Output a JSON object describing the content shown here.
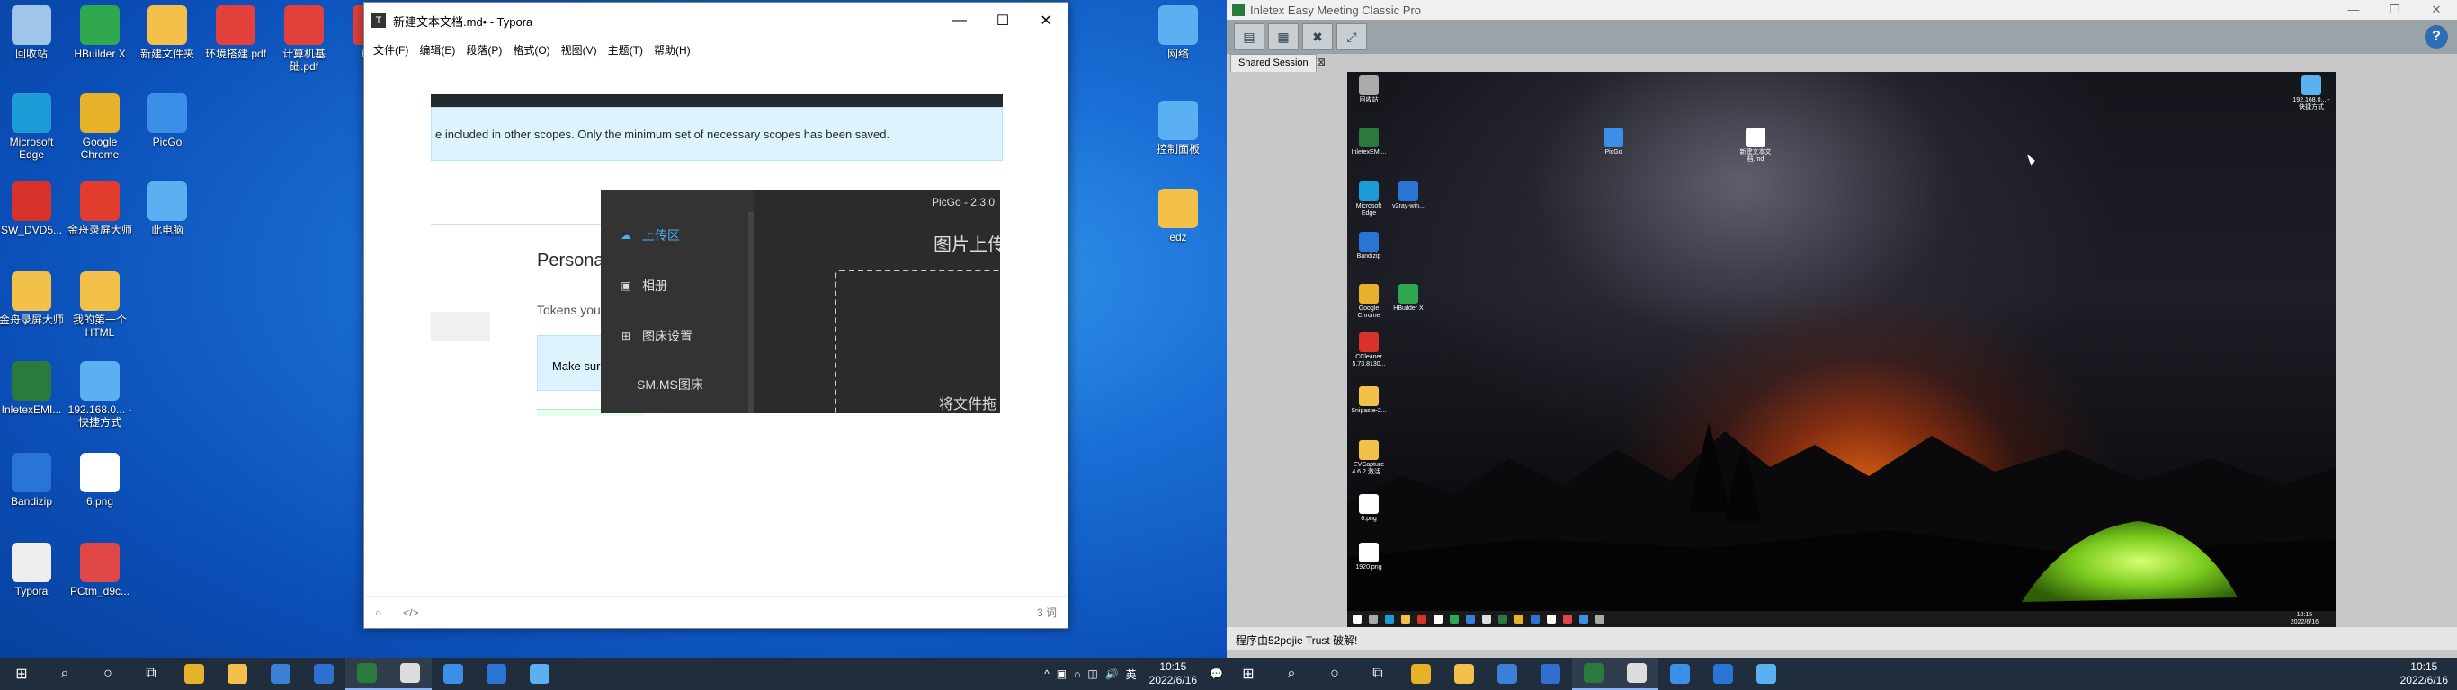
{
  "left": {
    "desktop_icons": [
      {
        "label": "回收站",
        "icon": "recycle-bin-icon",
        "color": "#9fc5e8"
      },
      {
        "label": "HBuilder X",
        "icon": "hbuilder-icon",
        "color": "#2fa84f"
      },
      {
        "label": "新建文件夹",
        "icon": "folder-icon",
        "color": "#f3c04a"
      },
      {
        "label": "环境搭建.pdf",
        "icon": "pdf-icon",
        "color": "#e2413b"
      },
      {
        "label": "计算机基础.pdf",
        "icon": "pdf-icon",
        "color": "#e2413b"
      },
      {
        "label": "HTN",
        "icon": "pdf-icon",
        "color": "#e2413b"
      },
      {
        "label": "Microsoft Edge",
        "icon": "edge-icon",
        "color": "#1d9bd7"
      },
      {
        "label": "Google Chrome",
        "icon": "chrome-icon",
        "color": "#e7b22a"
      },
      {
        "label": "PicGo",
        "icon": "picgo-icon",
        "color": "#3b8fe8"
      },
      {
        "label": "SW_DVD5...",
        "icon": "iso-icon",
        "color": "#d9322b"
      },
      {
        "label": "金舟录屏大师",
        "icon": "recorder-icon",
        "color": "#e23c2f"
      },
      {
        "label": "此电脑",
        "icon": "computer-icon",
        "color": "#5ab0f0"
      },
      {
        "label": "金舟录屏大师",
        "icon": "folder-icon",
        "color": "#f3c04a"
      },
      {
        "label": "我的第一个HTML",
        "icon": "chrome-file-icon",
        "color": "#f3c04a"
      },
      {
        "label": "InletexEMI...",
        "icon": "inletex-icon",
        "color": "#2b7a3d"
      },
      {
        "label": "192.168.0... - 快捷方式",
        "icon": "remote-pc-icon",
        "color": "#5ab0f0"
      },
      {
        "label": "Bandizip",
        "icon": "bandizip-icon",
        "color": "#2a74d6"
      },
      {
        "label": "6.png",
        "icon": "image-file-icon",
        "color": "#ffffff"
      },
      {
        "label": "Typora",
        "icon": "typora-icon",
        "color": "#eeeeee"
      },
      {
        "label": "PCtm_d9c...",
        "icon": "image-file-icon",
        "color": "#e04848"
      },
      {
        "label": "网络",
        "icon": "network-icon",
        "color": "#5ab0f0"
      },
      {
        "label": "控制面板",
        "icon": "control-panel-icon",
        "color": "#5ab0f0"
      },
      {
        "label": "edz",
        "icon": "user-folder-icon",
        "color": "#f3c04a"
      }
    ],
    "typora": {
      "title": "新建文本文档.md• - Typora",
      "app_icon": "T",
      "controls": {
        "minimize": "—",
        "maximize": "☐",
        "close": "✕"
      },
      "menu": [
        "文件(F)",
        "编辑(E)",
        "段落(P)",
        "格式(O)",
        "视图(V)",
        "主题(T)",
        "帮助(H)"
      ],
      "info_text": "e included in other scopes. Only the minimum set of necessary scopes has been saved.",
      "personal": "Personal",
      "tokens": "Tokens you",
      "make_sure": "Make sur",
      "status_left_icon": "○",
      "status_code_icon": "</>",
      "word_count": "3 词"
    },
    "picgo": {
      "title": "PicGo - 2.3.0",
      "menu": [
        {
          "label": "上传区",
          "icon": "cloud-upload-icon",
          "glyph": "☁",
          "active": true
        },
        {
          "label": "相册",
          "icon": "album-icon",
          "glyph": "▣",
          "active": false
        },
        {
          "label": "图床设置",
          "icon": "grid-icon",
          "glyph": "⊞",
          "active": false
        },
        {
          "label": "SM.MS图床",
          "icon": "",
          "glyph": "",
          "active": false
        }
      ],
      "heading": "图片上传",
      "drop_text": "将文件拖"
    },
    "taskbar": {
      "start": "⊞",
      "search": "⌕",
      "cortana": "○",
      "taskview": "⧉",
      "apps": [
        {
          "name": "chrome",
          "color": "#e7b22a",
          "active": false
        },
        {
          "name": "explorer",
          "color": "#f3c04a",
          "active": false
        },
        {
          "name": "store",
          "color": "#3b7fd6",
          "active": false
        },
        {
          "name": "mail",
          "color": "#2f6fd0",
          "active": false
        },
        {
          "name": "inletex",
          "color": "#2b7a3d",
          "active": true
        },
        {
          "name": "typora",
          "color": "#dddddd",
          "active": true
        },
        {
          "name": "picgo",
          "color": "#3b8fe8",
          "active": false
        },
        {
          "name": "vscode-like",
          "color": "#2a74d6",
          "active": false
        },
        {
          "name": "remote",
          "color": "#5ab0f0",
          "active": false
        }
      ],
      "tray": [
        "^",
        "▣",
        "⌂",
        "◫",
        "🔊",
        "英"
      ],
      "time": "10:15",
      "date": "2022/6/16",
      "notify": "💬"
    }
  },
  "meeting": {
    "title": "Inletex Easy Meeting Classic Pro",
    "controls": {
      "minimize": "—",
      "maximize": "❐",
      "close": "✕"
    },
    "tools": [
      "▤",
      "▦",
      "✖",
      "⤢"
    ],
    "help": "?",
    "tab": "Shared Session",
    "tab_close": "⊠",
    "status": "程序由52pojie Trust 破解!",
    "remote": {
      "icons": [
        {
          "label": "回收站",
          "color": "#aaaaaa"
        },
        {
          "label": "InletexEMI...",
          "color": "#2b7a3d"
        },
        {
          "label": "PicGo",
          "color": "#3b8fe8"
        },
        {
          "label": "新建文本文档.md",
          "color": "#ffffff"
        },
        {
          "label": "Microsoft Edge",
          "color": "#1d9bd7"
        },
        {
          "label": "v2ray-win...",
          "color": "#2a74d6"
        },
        {
          "label": "Bandizip",
          "color": "#2a74d6"
        },
        {
          "label": "Google Chrome",
          "color": "#e7b22a"
        },
        {
          "label": "HBuilder X",
          "color": "#2fa84f"
        },
        {
          "label": "CCleaner 5.73.8130...",
          "color": "#d9322b"
        },
        {
          "label": "Snipaste-2...",
          "color": "#f3c04a"
        },
        {
          "label": "EVCapture 4.6.2 激活...",
          "color": "#f3c04a"
        },
        {
          "label": "6.png",
          "color": "#ffffff"
        },
        {
          "label": "1920.png",
          "color": "#ffffff"
        },
        {
          "label": "192.168.0... - 快捷方式",
          "color": "#5ab0f0"
        }
      ],
      "taskbar_colors": [
        "#ffffff",
        "#aaaaaa",
        "#1d9bd7",
        "#f3c04a",
        "#d9322b",
        "#ffffff",
        "#2fa84f",
        "#3b7fd6",
        "#dddddd",
        "#2b7a3d",
        "#e7b22a",
        "#2a74d6",
        "#ffffff",
        "#e04848",
        "#3b8fe8",
        "#aaaaaa"
      ],
      "time": "10:15",
      "date": "2022/6/16"
    },
    "taskbar": {
      "time": "10:15",
      "date": "2022/6/16"
    }
  }
}
